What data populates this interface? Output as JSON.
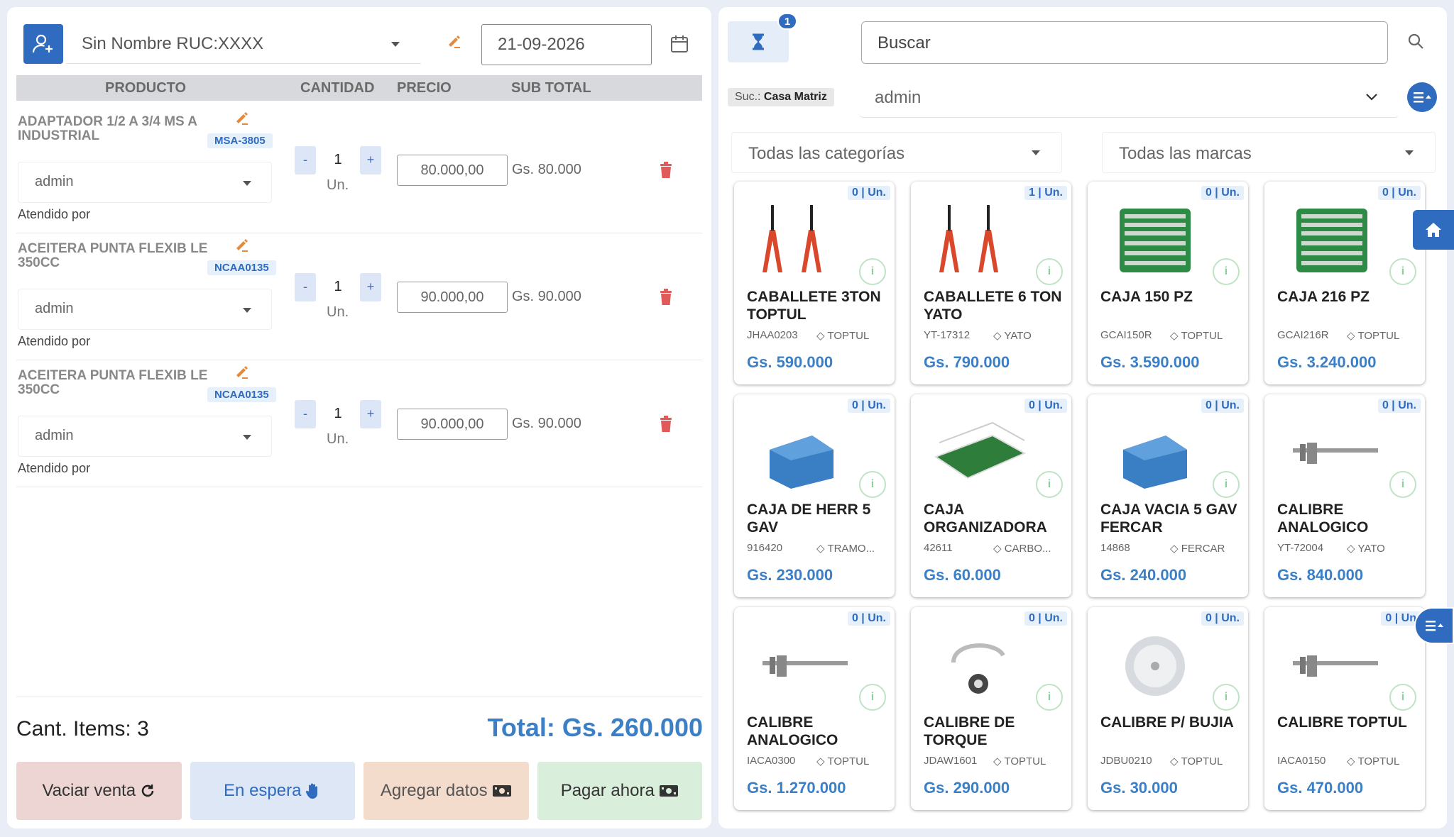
{
  "client": {
    "name": "Sin Nombre RUC:XXXX",
    "date": "21-09-2026"
  },
  "table": {
    "headers": {
      "product": "PRODUCTO",
      "qty": "CANTIDAD",
      "price": "PRECIO",
      "subtotal": "SUB TOTAL"
    }
  },
  "rows": [
    {
      "name": "ADAPTADOR 1/2 A 3/4 MS A INDUSTRIAL",
      "code": "MSA-3805",
      "seller": "admin",
      "qty": "1",
      "unit": "Un.",
      "price": "80.000,00",
      "subtotal": "Gs. 80.000",
      "atendido": "Atendido por",
      "minus": "-",
      "plus": "+"
    },
    {
      "name": "ACEITERA PUNTA FLEXIB LE 350CC",
      "code": "NCAA0135",
      "seller": "admin",
      "qty": "1",
      "unit": "Un.",
      "price": "90.000,00",
      "subtotal": "Gs. 90.000",
      "atendido": "Atendido por",
      "minus": "-",
      "plus": "+"
    },
    {
      "name": "ACEITERA PUNTA FLEXIB LE 350CC",
      "code": "NCAA0135",
      "seller": "admin",
      "qty": "1",
      "unit": "Un.",
      "price": "90.000,00",
      "subtotal": "Gs. 90.000",
      "atendido": "Atendido por",
      "minus": "-",
      "plus": "+"
    }
  ],
  "summary": {
    "items_label": "Cant. Items:",
    "items_count": "3",
    "total": "Total: Gs. 260.000"
  },
  "actions": {
    "vaciar": "Vaciar venta",
    "espera": "En espera",
    "datos": "Agregar datos",
    "pagar": "Pagar ahora"
  },
  "right": {
    "pending_count": "1",
    "search_placeholder": "Buscar",
    "suc_label": "Suc.:",
    "suc_value": "Casa Matriz",
    "user": "admin",
    "categories": "Todas las categorías",
    "brands": "Todas las marcas"
  },
  "products": [
    {
      "stock": "0 | Un.",
      "name": "CABALLETE 3TON TOPTUL",
      "code": "JHAA0203",
      "brand": "TOPTUL",
      "price": "Gs. 590.000",
      "icon": "jack-stand-icon"
    },
    {
      "stock": "1 | Un.",
      "name": "CABALLETE 6 TON YATO",
      "code": "YT-17312",
      "brand": "YATO",
      "price": "Gs. 790.000",
      "icon": "jack-stand-icon"
    },
    {
      "stock": "0 | Un.",
      "name": "CAJA 150 PZ",
      "code": "GCAI150R",
      "brand": "TOPTUL",
      "price": "Gs. 3.590.000",
      "icon": "toolcase-icon"
    },
    {
      "stock": "0 | Un.",
      "name": "CAJA 216 PZ",
      "code": "GCAI216R",
      "brand": "TOPTUL",
      "price": "Gs. 3.240.000",
      "icon": "toolcase-icon"
    },
    {
      "stock": "0 | Un.",
      "name": "CAJA DE HERR 5 GAV",
      "code": "916420",
      "brand": "TRAMO...",
      "price": "Gs. 230.000",
      "icon": "toolbox-icon"
    },
    {
      "stock": "0 | Un.",
      "name": "CAJA ORGANIZADORA",
      "code": "42611",
      "brand": "CARBO...",
      "price": "Gs. 60.000",
      "icon": "organizer-icon"
    },
    {
      "stock": "0 | Un.",
      "name": "CAJA VACIA 5 GAV FERCAR",
      "code": "14868",
      "brand": "FERCAR",
      "price": "Gs. 240.000",
      "icon": "toolbox-icon"
    },
    {
      "stock": "0 | Un.",
      "name": "CALIBRE ANALOGICO",
      "code": "YT-72004",
      "brand": "YATO",
      "price": "Gs. 840.000",
      "icon": "caliper-icon"
    },
    {
      "stock": "0 | Un.",
      "name": "CALIBRE ANALOGICO",
      "code": "IACA0300",
      "brand": "TOPTUL",
      "price": "Gs. 1.270.000",
      "icon": "caliper-icon"
    },
    {
      "stock": "0 | Un.",
      "name": "CALIBRE DE TORQUE",
      "code": "JDAW1601",
      "brand": "TOPTUL",
      "price": "Gs. 290.000",
      "icon": "torque-gauge-icon"
    },
    {
      "stock": "0 | Un.",
      "name": "CALIBRE P/ BUJIA",
      "code": "JDBU0210",
      "brand": "TOPTUL",
      "price": "Gs. 30.000",
      "icon": "spark-gauge-icon"
    },
    {
      "stock": "0 | Un",
      "name": "CALIBRE TOPTUL",
      "code": "IACA0150",
      "brand": "TOPTUL",
      "price": "Gs. 470.000",
      "icon": "caliper-icon"
    }
  ],
  "colors": {
    "accent": "#2f6bbf",
    "price": "#3b7fc6",
    "danger": "#e05a5a"
  }
}
